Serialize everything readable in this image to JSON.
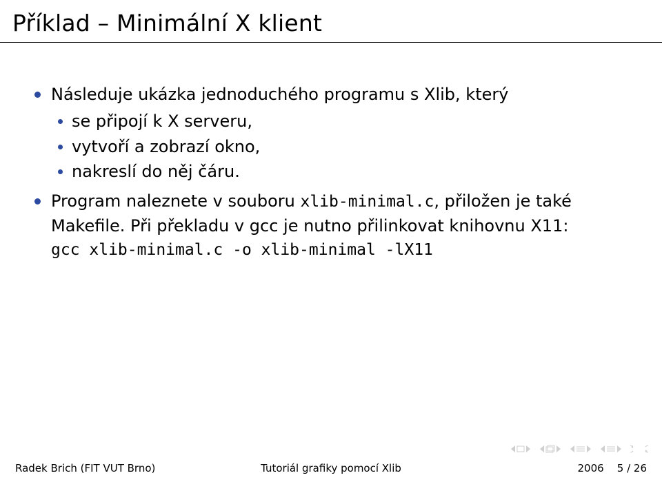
{
  "title": "Příklad – Minimální X klient",
  "bullets": {
    "b1": "Následuje ukázka jednoduchého programu s Xlib, který",
    "sub1": "se připojí k X serveru,",
    "sub2": "vytvoří a zobrazí okno,",
    "sub3": "nakreslí do něj čáru.",
    "b2_a": "Program naleznete v souboru ",
    "b2_code1": "xlib-minimal.c",
    "b2_b": ", přiložen je také Makefile. Při překladu v gcc je nutno přilinkovat knihovnu X11:",
    "b2_cmd": "gcc xlib-minimal.c -o xlib-minimal -lX11"
  },
  "footer": {
    "left": "Radek Brich (FIT VUT Brno)",
    "center": "Tutoriál grafiky pomocí Xlib",
    "right_year": "2006",
    "right_page": "5 / 26"
  }
}
